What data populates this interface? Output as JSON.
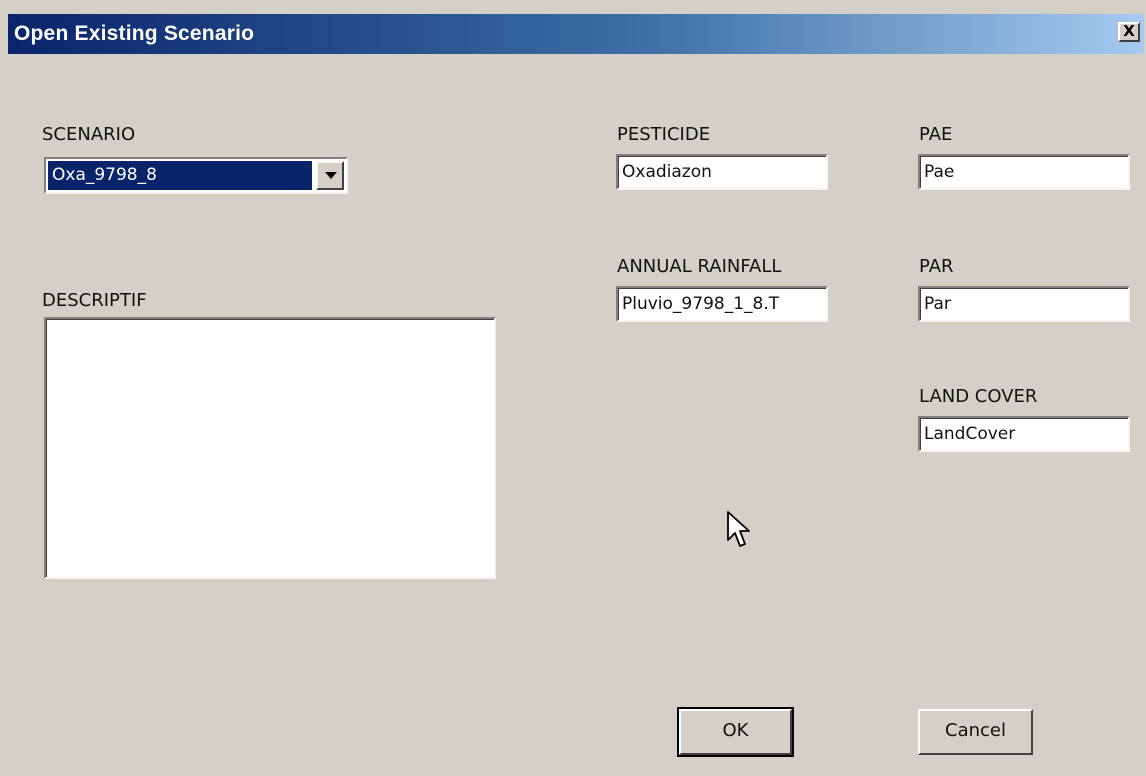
{
  "window": {
    "title": "Open Existing Scenario",
    "close_label": "X"
  },
  "scenario": {
    "label": "SCENARIO",
    "selected": "Oxa_9798_8"
  },
  "descriptif": {
    "label": "DESCRIPTIF",
    "value": ""
  },
  "pesticide": {
    "label": "PESTICIDE",
    "value": "Oxadiazon"
  },
  "annual_rainfall": {
    "label": "ANNUAL RAINFALL",
    "value": "Pluvio_9798_1_8.T"
  },
  "pae": {
    "label": "PAE",
    "value": "Pae"
  },
  "par": {
    "label": "PAR",
    "value": "Par"
  },
  "land_cover": {
    "label": "LAND COVER",
    "value": "LandCover"
  },
  "buttons": {
    "ok": "OK",
    "cancel": "Cancel"
  },
  "colors": {
    "title_bar_start": "#0a246a",
    "title_bar_end": "#a6caf0",
    "dialog_background": "#d4d0c8",
    "selection": "#0a246a"
  },
  "icons": {
    "cursor": "mouse-pointer-icon",
    "close": "close-icon",
    "dropdown": "chevron-down-icon"
  }
}
